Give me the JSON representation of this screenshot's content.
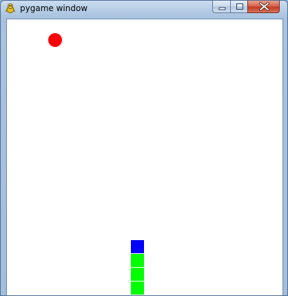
{
  "window": {
    "title": "pygame window"
  },
  "icons": {
    "app": "pygame-snake-icon",
    "minimize": "minimize-icon",
    "maximize": "maximize-icon",
    "close": "close-icon"
  },
  "colors": {
    "food": "#ff0000",
    "snake_head": "#0000ff",
    "snake_body": "#00ff00",
    "background": "#ffffff"
  },
  "game": {
    "food": {
      "col": 3,
      "row": 1
    },
    "snake": [
      {
        "part": "head",
        "col": 9,
        "row": 16
      },
      {
        "part": "body",
        "col": 9,
        "row": 17
      },
      {
        "part": "body",
        "col": 9,
        "row": 18
      },
      {
        "part": "body",
        "col": 9,
        "row": 19
      }
    ]
  }
}
